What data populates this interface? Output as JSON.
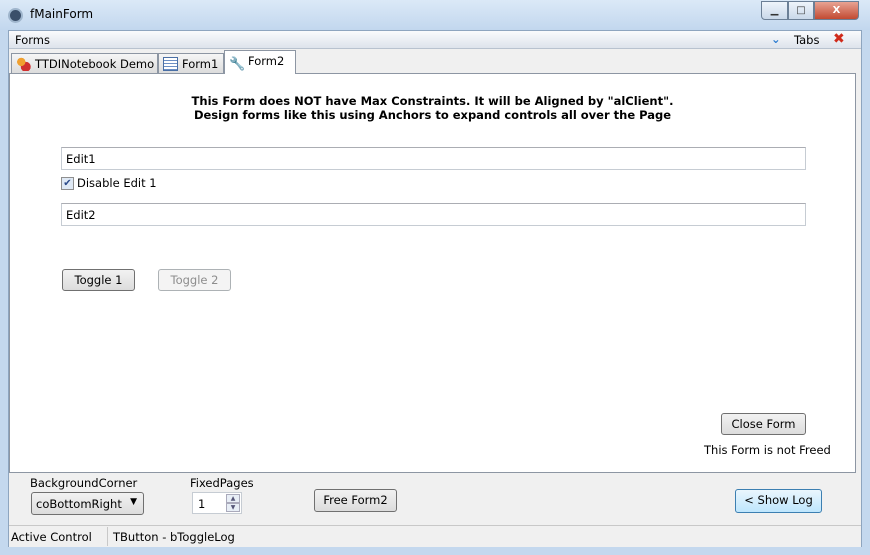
{
  "window": {
    "title": "fMainForm",
    "minimize": "▁",
    "maximize": "□",
    "close": "X"
  },
  "formsbar": {
    "label": "Forms",
    "tabs_label": "Tabs",
    "tabs_icon": "chevron-down-icon",
    "close_icon": "close-icon"
  },
  "tabs": [
    {
      "label": "TTDINotebook Demo",
      "icon": "users-icon"
    },
    {
      "label": "Form1",
      "icon": "form-icon"
    },
    {
      "label": "Form2",
      "icon": "wrench-icon",
      "active": true
    }
  ],
  "page": {
    "info_line1": "This Form does NOT have Max Constraints. It will be Aligned by \"alClient\".",
    "info_line2": "Design forms like this using Anchors to expand controls all over the Page",
    "edit1": "Edit1",
    "checkbox": {
      "label": "Disable Edit 1",
      "checked": true
    },
    "edit2": "Edit2",
    "toggle1": "Toggle 1",
    "toggle2": "Toggle 2",
    "close_form": "Close Form",
    "freed_status": "This Form is not Freed"
  },
  "bottom": {
    "bg_corner_label": "BackgroundCorner",
    "bg_corner_value": "coBottomRight",
    "fixed_pages_label": "FixedPages",
    "fixed_pages_value": "1",
    "free_form": "Free Form2",
    "show_log": "< Show Log"
  },
  "status": {
    "panel1": "Active Control",
    "panel2": "TButton - bToggleLog"
  }
}
